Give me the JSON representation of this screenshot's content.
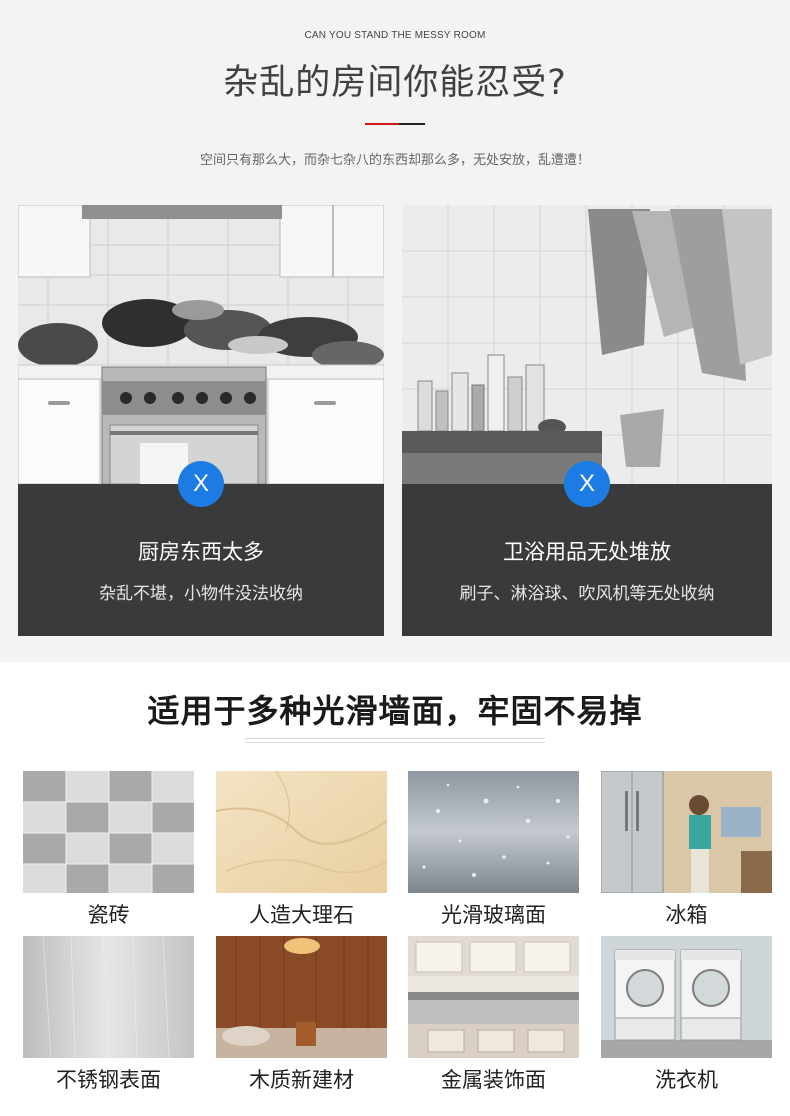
{
  "header": {
    "eyebrow": "CAN YOU STAND THE MESSY ROOM",
    "title": "杂乱的房间你能忍受?",
    "subtitle": "空间只有那么大，而杂七杂八的东西却那么多，无处安放，乱遭遭！"
  },
  "problems": [
    {
      "badge": "X",
      "title": "厨房东西太多",
      "desc": "杂乱不堪，小物件没法收纳"
    },
    {
      "badge": "X",
      "title": "卫浴用品无处堆放",
      "desc": "刷子、淋浴球、吹风机等无处收纳"
    }
  ],
  "surfaces": {
    "title": "适用于多种光滑墙面，牢固不易掉",
    "items": [
      {
        "label": "瓷砖"
      },
      {
        "label": "人造大理石"
      },
      {
        "label": "光滑玻璃面"
      },
      {
        "label": "冰箱"
      },
      {
        "label": "不锈钢表面"
      },
      {
        "label": "木质新建材"
      },
      {
        "label": "金属装饰面"
      },
      {
        "label": "洗衣机"
      }
    ]
  },
  "colors": {
    "accent_red": "#d0191f",
    "badge_blue": "#1d7ce3",
    "card_dark": "#3a3a3c"
  }
}
